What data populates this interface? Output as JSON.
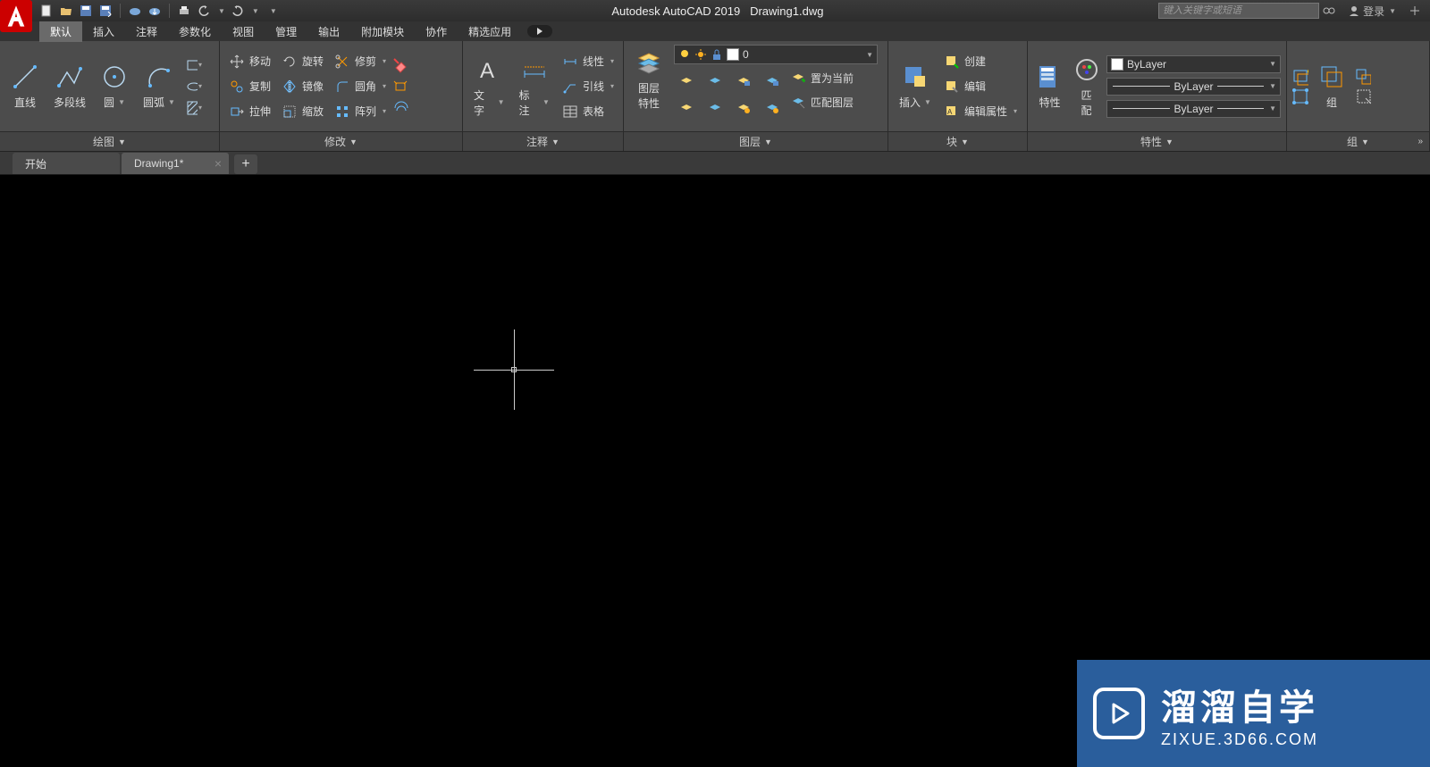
{
  "title": {
    "app": "Autodesk AutoCAD 2019",
    "file": "Drawing1.dwg"
  },
  "search": {
    "placeholder": "键入关键字或短语"
  },
  "login": {
    "label": "登录"
  },
  "menu": {
    "tabs": [
      "默认",
      "插入",
      "注释",
      "参数化",
      "视图",
      "管理",
      "输出",
      "附加模块",
      "协作",
      "精选应用"
    ]
  },
  "ribbon": {
    "draw": {
      "title": "绘图",
      "line": "直线",
      "polyline": "多段线",
      "circle": "圆",
      "arc": "圆弧"
    },
    "modify": {
      "title": "修改",
      "move": "移动",
      "rotate": "旋转",
      "trim": "修剪",
      "copy": "复制",
      "mirror": "镜像",
      "fillet": "圆角",
      "stretch": "拉伸",
      "scale": "缩放",
      "array": "阵列"
    },
    "annotate": {
      "title": "注释",
      "text": "文字",
      "dim": "标注",
      "linear": "线性",
      "leader": "引线",
      "table": "表格"
    },
    "layers": {
      "title": "图层",
      "props": "图层\n特性",
      "current": "0",
      "setCurrent": "置为当前",
      "match": "匹配图层"
    },
    "block": {
      "title": "块",
      "insert": "插入",
      "create": "创建",
      "edit": "编辑",
      "editAttr": "编辑属性"
    },
    "properties": {
      "title": "特性",
      "props": "特性",
      "match": "匹\n配",
      "bylayer": "ByLayer"
    },
    "group": {
      "title": "组",
      "label": "组"
    }
  },
  "filetabs": {
    "start": "开始",
    "drawing": "Drawing1*"
  },
  "watermark": {
    "main": "溜溜自学",
    "sub": "ZIXUE.3D66.COM"
  }
}
